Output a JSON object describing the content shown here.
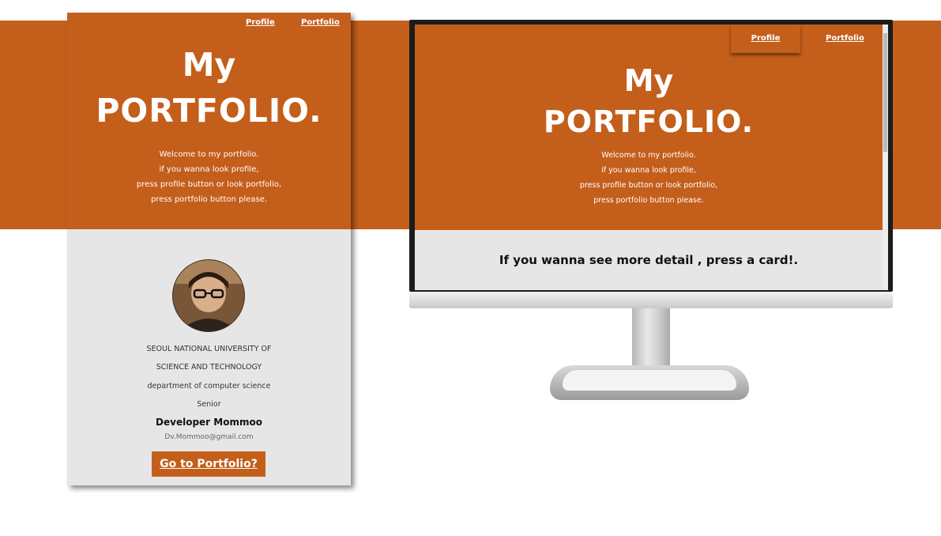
{
  "colors": {
    "accent": "#c45e1b",
    "panel_bg": "#e7e6e7",
    "text_light": "#ffffff",
    "text_dark": "#111111"
  },
  "mobile": {
    "nav": {
      "profile": "Profile",
      "portfolio": "Portfolio"
    },
    "hero": {
      "title_line1": "My",
      "title_line2": "PORTFOLIO.",
      "welcome": [
        "Welcome to my portfolio.",
        "if you wanna look profile,",
        "press profile button or look portfolio,",
        "press portfolio button please."
      ]
    },
    "profile": {
      "avatar_icon": "user-photo",
      "school_line1": "SEOUL NATIONAL UNIVERSITY OF",
      "school_line2": "SCIENCE AND TECHNOLOGY",
      "department": "department of computer science",
      "grade": "Senior",
      "name": "Developer Mommoo",
      "email": "Dv.Mommoo@gmail.com",
      "cta": "Go to Portfolio?"
    }
  },
  "desktop": {
    "nav": {
      "profile": "Profile",
      "portfolio": "Portfolio"
    },
    "hero": {
      "title_line1": "My",
      "title_line2": "PORTFOLIO.",
      "welcome": [
        "Welcome to my portfolio.",
        "if you wanna look profile,",
        "press profile button or look portfolio,",
        "press portfolio button please."
      ]
    },
    "detail_prompt": "If you wanna see more detail , press a card!."
  }
}
